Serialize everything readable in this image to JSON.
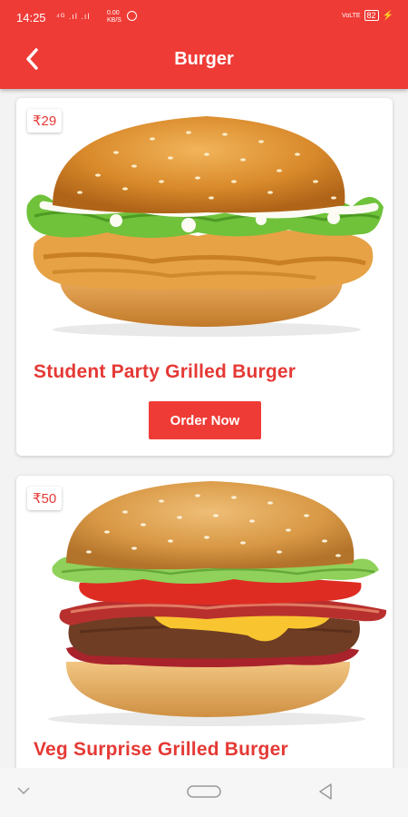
{
  "status": {
    "time": "14:25",
    "left_icons": "⁴ᴳ .ıl .ıl",
    "speed": "0.00 KB/S",
    "right_label": "VoLTE",
    "battery": "82"
  },
  "header": {
    "title": "Burger",
    "back_icon": "arrow-left-icon"
  },
  "items": [
    {
      "price": "₹29",
      "name": "Student Party Grilled Burger",
      "button_label": "Order Now"
    },
    {
      "price": "₹50",
      "name": "Veg Surprise Grilled Burger"
    }
  ],
  "navbar": {
    "icons": [
      "chevron-down-icon",
      "home-pill-icon",
      "back-triangle-icon"
    ]
  },
  "colors": {
    "accent": "#ef3b36",
    "text_accent": "#e53935"
  }
}
